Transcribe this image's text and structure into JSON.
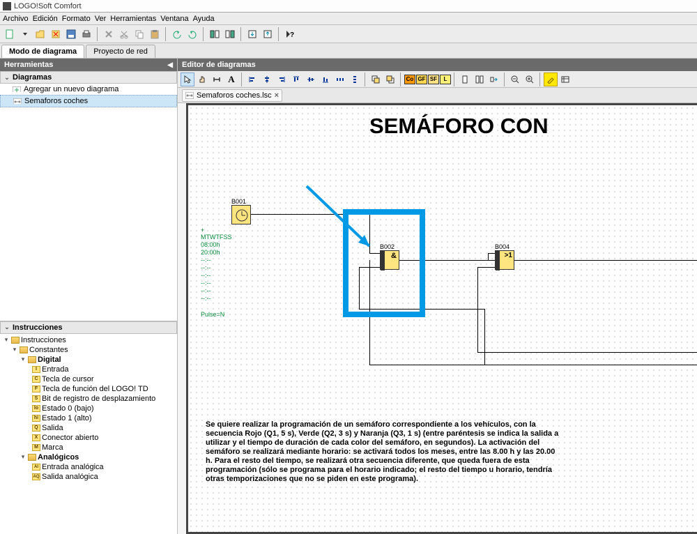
{
  "title": "LOGO!Soft Comfort",
  "menu": {
    "archivo": "Archivo",
    "edicion": "Edición",
    "formato": "Formato",
    "ver": "Ver",
    "herramientas": "Herramientas",
    "ventana": "Ventana",
    "ayuda": "Ayuda"
  },
  "tabs": {
    "diagram": "Modo de diagrama",
    "project": "Proyecto de red"
  },
  "leftPanel": {
    "tools": "Herramientas",
    "diagrams": "Diagramas",
    "addNew": "Agregar un nuevo diagrama",
    "item": "Semaforos coches",
    "instrHdr": "Instrucciones",
    "instrRoot": "Instrucciones",
    "constantes": "Constantes",
    "digital": "Digital",
    "digitalItems": [
      {
        "code": "I",
        "label": "Entrada"
      },
      {
        "code": "C",
        "label": "Tecla de cursor"
      },
      {
        "code": "F",
        "label": "Tecla de función del LOGO! TD"
      },
      {
        "code": "S",
        "label": "Bit de registro de desplazamiento"
      },
      {
        "code": "lo",
        "label": "Estado 0 (bajo)"
      },
      {
        "code": "hi",
        "label": "Estado 1 (alto)"
      },
      {
        "code": "Q",
        "label": "Salida"
      },
      {
        "code": "X",
        "label": "Conector abierto"
      },
      {
        "code": "M",
        "label": "Marca"
      }
    ],
    "analogicos": "Analógicos",
    "analogItems": [
      {
        "code": "AI",
        "label": "Entrada analógica"
      },
      {
        "code": "AQ",
        "label": "Salida analógica"
      }
    ]
  },
  "editor": {
    "header": "Editor de diagramas",
    "docTab": "Semaforos coches.lsc",
    "close": "×",
    "title": "SEMÁFORO CON",
    "blocks": {
      "b001": "B001",
      "b002": "B002",
      "b004": "B004",
      "and": "&",
      "or": ">1"
    },
    "params": {
      "plus": "+",
      "days": "MTWTFSS",
      "t1": "08:00h",
      "t2": "20:00h",
      "dash": "--:--",
      "pulse": "Pulse=N"
    },
    "desc": "Se quiere realizar la programación de un semáforo correspondiente a los vehículos, con la secuencia Rojo (Q1, 5 s), Verde (Q2, 3 s) y Naranja (Q3, 1 s) (entre paréntesis se indica la salida a utilizar y el tiempo de duración de cada color del semáforo, en segundos). La activación del semáforo se realizará mediante horario: se activará todos los meses, entre las 8.00 h y las 20.00 h. Para el resto del tiempo, se realizará otra secuencia diferente, que queda fuera de esta programación (sólo se programa para el horario indicado; el resto del tiempo u horario, tendría otras temporizaciones que no se piden en este programa)."
  },
  "colorBtns": {
    "co": "Co",
    "gf": "GF",
    "sf": "SF",
    "l": "L"
  }
}
